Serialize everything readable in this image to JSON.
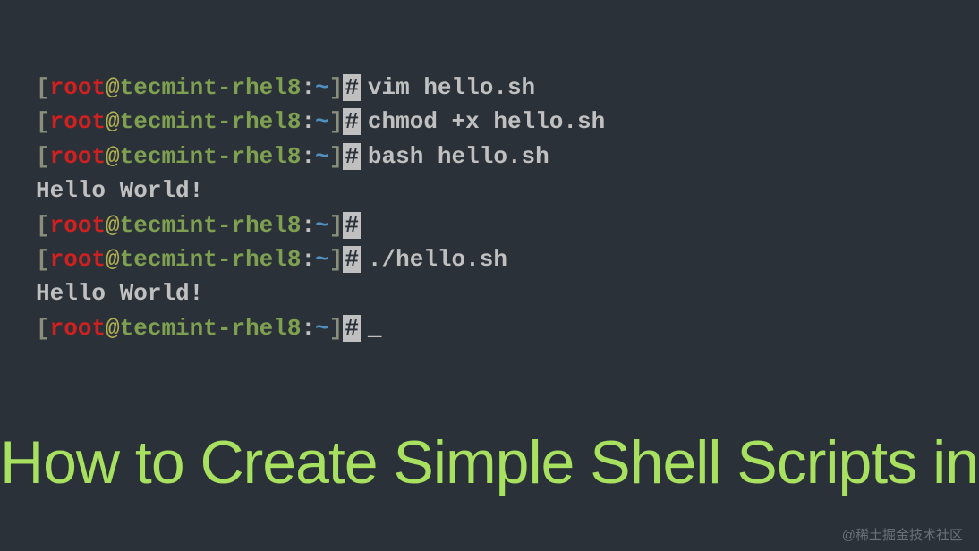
{
  "prompt": {
    "open_bracket": "[",
    "user": "root",
    "at": "@",
    "host": "tecmint-rhel8",
    "colon": ":",
    "path": "~",
    "close_bracket": "]",
    "hash": "#"
  },
  "lines": {
    "cmd1": "vim hello.sh",
    "cmd2": "chmod +x hello.sh",
    "cmd3": "bash hello.sh",
    "out1": "Hello World!",
    "cmd4": "",
    "cmd5": "./hello.sh",
    "out2": "Hello World!",
    "cursor": "_"
  },
  "title": "How to Create Simple Shell Scripts in Linux",
  "watermark": "@稀土掘金技术社区"
}
